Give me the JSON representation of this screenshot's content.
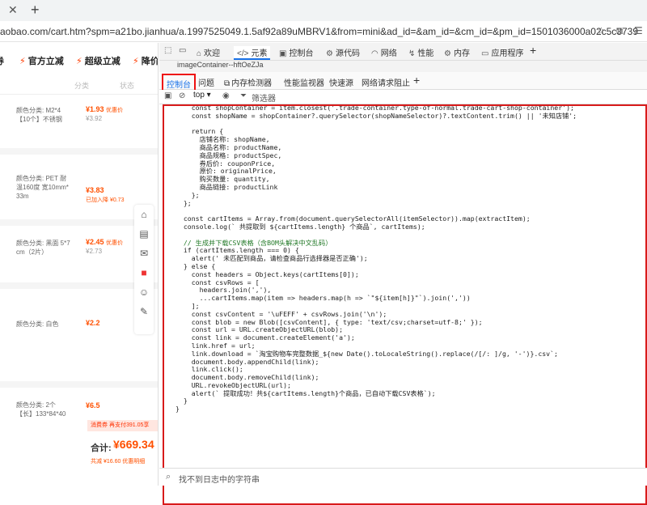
{
  "browser": {
    "new_tab_icon": "plus-icon",
    "close_tab_icon": "close-icon",
    "url": "aobao.com/cart.htm?spm=a21bo.jianhua/a.1997525049.1.5af92a89uMBRV1&from=mini&ad_id=&am_id=&cm_id=&pm_id=1501036000a02c5c3739",
    "tab_close": "✕",
    "new_tab": "+"
  },
  "cart": {
    "promos": [
      "券",
      "官方立减",
      "超级立减",
      "降价"
    ],
    "head_selects": [
      "分类",
      "状态"
    ],
    "items": [
      {
        "spec": "颜色分类: M2*4\n【10个】不锈钢",
        "price": "¥1.93",
        "sub": "优惠价",
        "orig": "¥3.92"
      },
      {
        "spec": "颜色分类: PET 耐\n温160度 宽10mm*\n33m",
        "price": "¥3.83",
        "sub": "已加入降 ¥0.73",
        "orig": ""
      },
      {
        "spec": "颜色分类: 黑面 5*7\ncm（2片）",
        "price": "¥2.45",
        "sub": "优惠价",
        "orig": "¥2.73"
      },
      {
        "spec": "颜色分类: 白色",
        "price": "¥2.2",
        "sub": "",
        "orig": ""
      },
      {
        "spec": "颜色分类: 2个\n【长】133*84*40",
        "price": "¥6.5",
        "sub": "",
        "orig": ""
      }
    ],
    "discount": "消费券    再支付391.05享",
    "total_label": "合计:",
    "total": "¥669.34",
    "saved": "共减 ¥16.60 优惠明细"
  },
  "devtools": {
    "top_tabs": [
      "欢迎",
      "元素",
      "控制台",
      "源代码",
      "网络",
      "性能",
      "内存",
      "应用程序"
    ],
    "add_tab": "+",
    "tooltip": "imageContainer--hftOeZJa",
    "drawer_tabs": [
      "控制台",
      "问题",
      "内存检测器",
      "性能监视器",
      "快速源",
      "网络请求阻止"
    ],
    "drawer_add": "+",
    "context": "top ▾",
    "filter": "筛选器",
    "input_placeholder": "找不到日志中的字符串",
    "code": {
      "l1": "    const shopContainer = item.closest('.trade-container.type-of-normal.trade-cart-shop-container');",
      "l2": "    const shopName = shopContainer?.querySelector(shopNameSelector)?.textContent.trim() || '未知店铺';",
      "l4": "    return {",
      "l5": "      店铺名称: shopName,",
      "l6": "      商品名称: productName,",
      "l7": "      商品规格: productSpec,",
      "l8": "      券后价: couponPrice,",
      "l9": "      原价: originalPrice,",
      "l10": "      购买数量: quantity,",
      "l11": "      商品链接: productLink",
      "l12": "    };",
      "l13": "  };",
      "l15": "  const cartItems = Array.from(document.querySelectorAll(itemSelector)).map(extractItem);",
      "l16": "  console.log(` 共提取到 ${cartItems.length} 个商品`, cartItems);",
      "l18": "  // 生成并下载CSV表格（含BOM头解决中文乱码）",
      "l19": "  if (cartItems.length === 0) {",
      "l20": "    alert(' 未匹配到商品，请检查商品行选择器是否正确');",
      "l21": "  } else {",
      "l22": "    const headers = Object.keys(cartItems[0]);",
      "l23": "    const csvRows = [",
      "l24": "      headers.join(','),",
      "l25": "      ...cartItems.map(item => headers.map(h => `\"${item[h]}\"`).join(','))",
      "l26": "    ];",
      "l27": "    const csvContent = '\\uFEFF' + csvRows.join('\\n');",
      "l28": "    const blob = new Blob([csvContent], { type: 'text/csv;charset=utf-8;' });",
      "l29": "    const url = URL.createObjectURL(blob);",
      "l30": "    const link = document.createElement('a');",
      "l31": "    link.href = url;",
      "l32": "    link.download = `淘宝购物车完整数据_${new Date().toLocaleString().replace(/[/: ]/g, '-')}.csv`;",
      "l33": "    document.body.appendChild(link);",
      "l34": "    link.click();",
      "l35": "    document.body.removeChild(link);",
      "l36": "    URL.revokeObjectURL(url);",
      "l37": "    alert(` 提取成功！共${cartItems.length}个商品，已自动下载CSV表格`);",
      "l38": "  }",
      "l39": "}"
    }
  }
}
